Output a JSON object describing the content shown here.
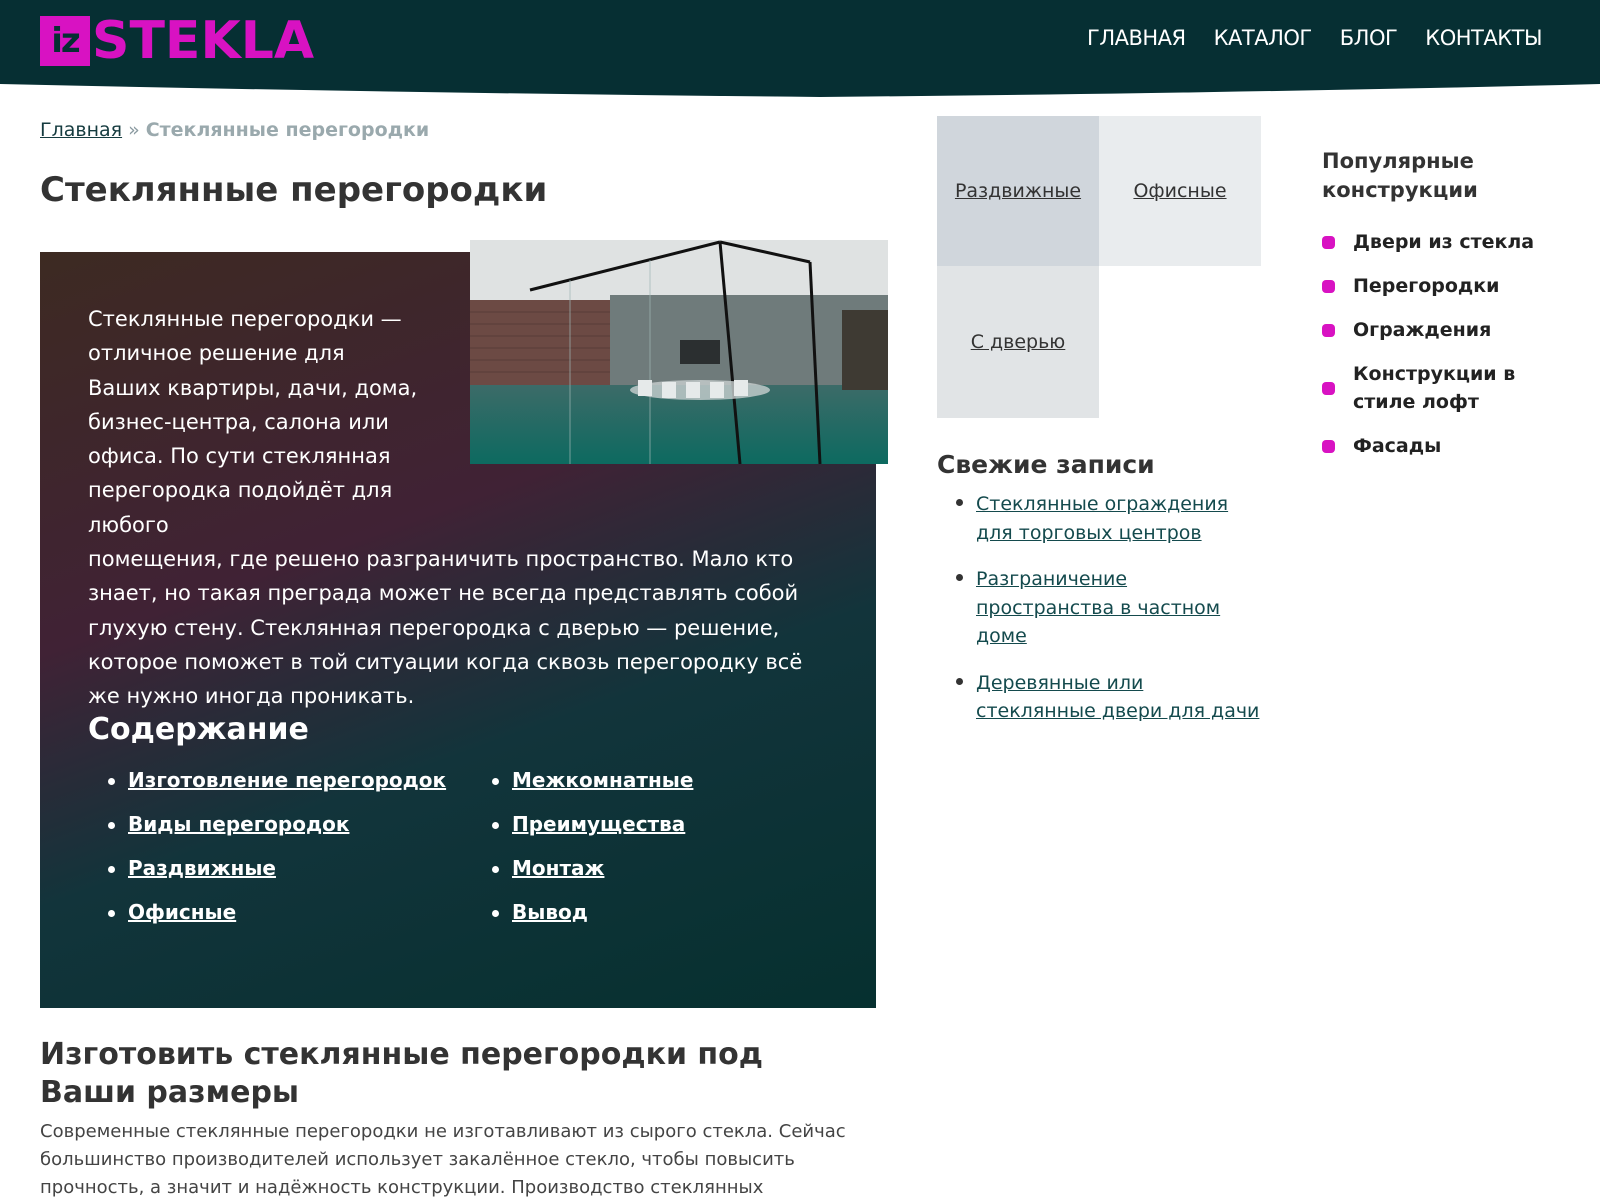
{
  "header": {
    "logo_box": "iz",
    "logo_text": "STEKLA",
    "nav": [
      "ГЛАВНАЯ",
      "КАТАЛОГ",
      "БЛОГ",
      "КОНТАКТЫ"
    ]
  },
  "breadcrumb": {
    "home": "Главная",
    "separator": "»",
    "current": "Стеклянные перегородки"
  },
  "page_title": "Стеклянные перегородки",
  "hero": {
    "intro_first": "Стеклянные перегородки — отличное решение для Ваших квартиры, дачи, дома, бизнес-центра, салона или офиса. По сути стеклянная перегородка подойдёт для любого",
    "intro_rest": "помещения, где решено разграничить пространство. Мало кто знает, но такая преграда может не всегда представлять собой глухую стену. Стеклянная перегородка с дверью — решение, которое поможет в той ситуации когда сквозь перегородку всё же нужно иногда проникать.",
    "toc_title": "Содержание",
    "toc_left": [
      "Изготовление перегородок",
      "Виды перегородок",
      "Раздвижные",
      "Офисные"
    ],
    "toc_right": [
      "Межкомнатные",
      "Преимущества",
      "Монтаж",
      "Вывод"
    ]
  },
  "section": {
    "title": "Изготовить стеклянные перегородки под Ваши размеры",
    "text": "Современные стеклянные перегородки не изготавливают из сырого стекла. Сейчас большинство производителей использует закалённое стекло, чтобы повысить прочность, а значит и надёжность конструкции. Производство стеклянных"
  },
  "tiles": [
    "Раздвижные",
    "Офисные",
    "С дверью"
  ],
  "fresh": {
    "title": "Свежие записи",
    "items": [
      "Стеклянные ограждения для торговых центров",
      "Разграничение пространства в частном доме",
      "Деревянные или стеклянные двери для дачи"
    ]
  },
  "popular": {
    "title": "Популярные конструкции",
    "items": [
      "Двери из стекла",
      "Перегородки",
      "Ограждения",
      "Конструкции в стиле лофт",
      "Фасады"
    ]
  },
  "colors": {
    "header_bg": "#062f33",
    "accent": "#d812c2"
  },
  "images": {
    "hero": "glass-office-photo"
  }
}
